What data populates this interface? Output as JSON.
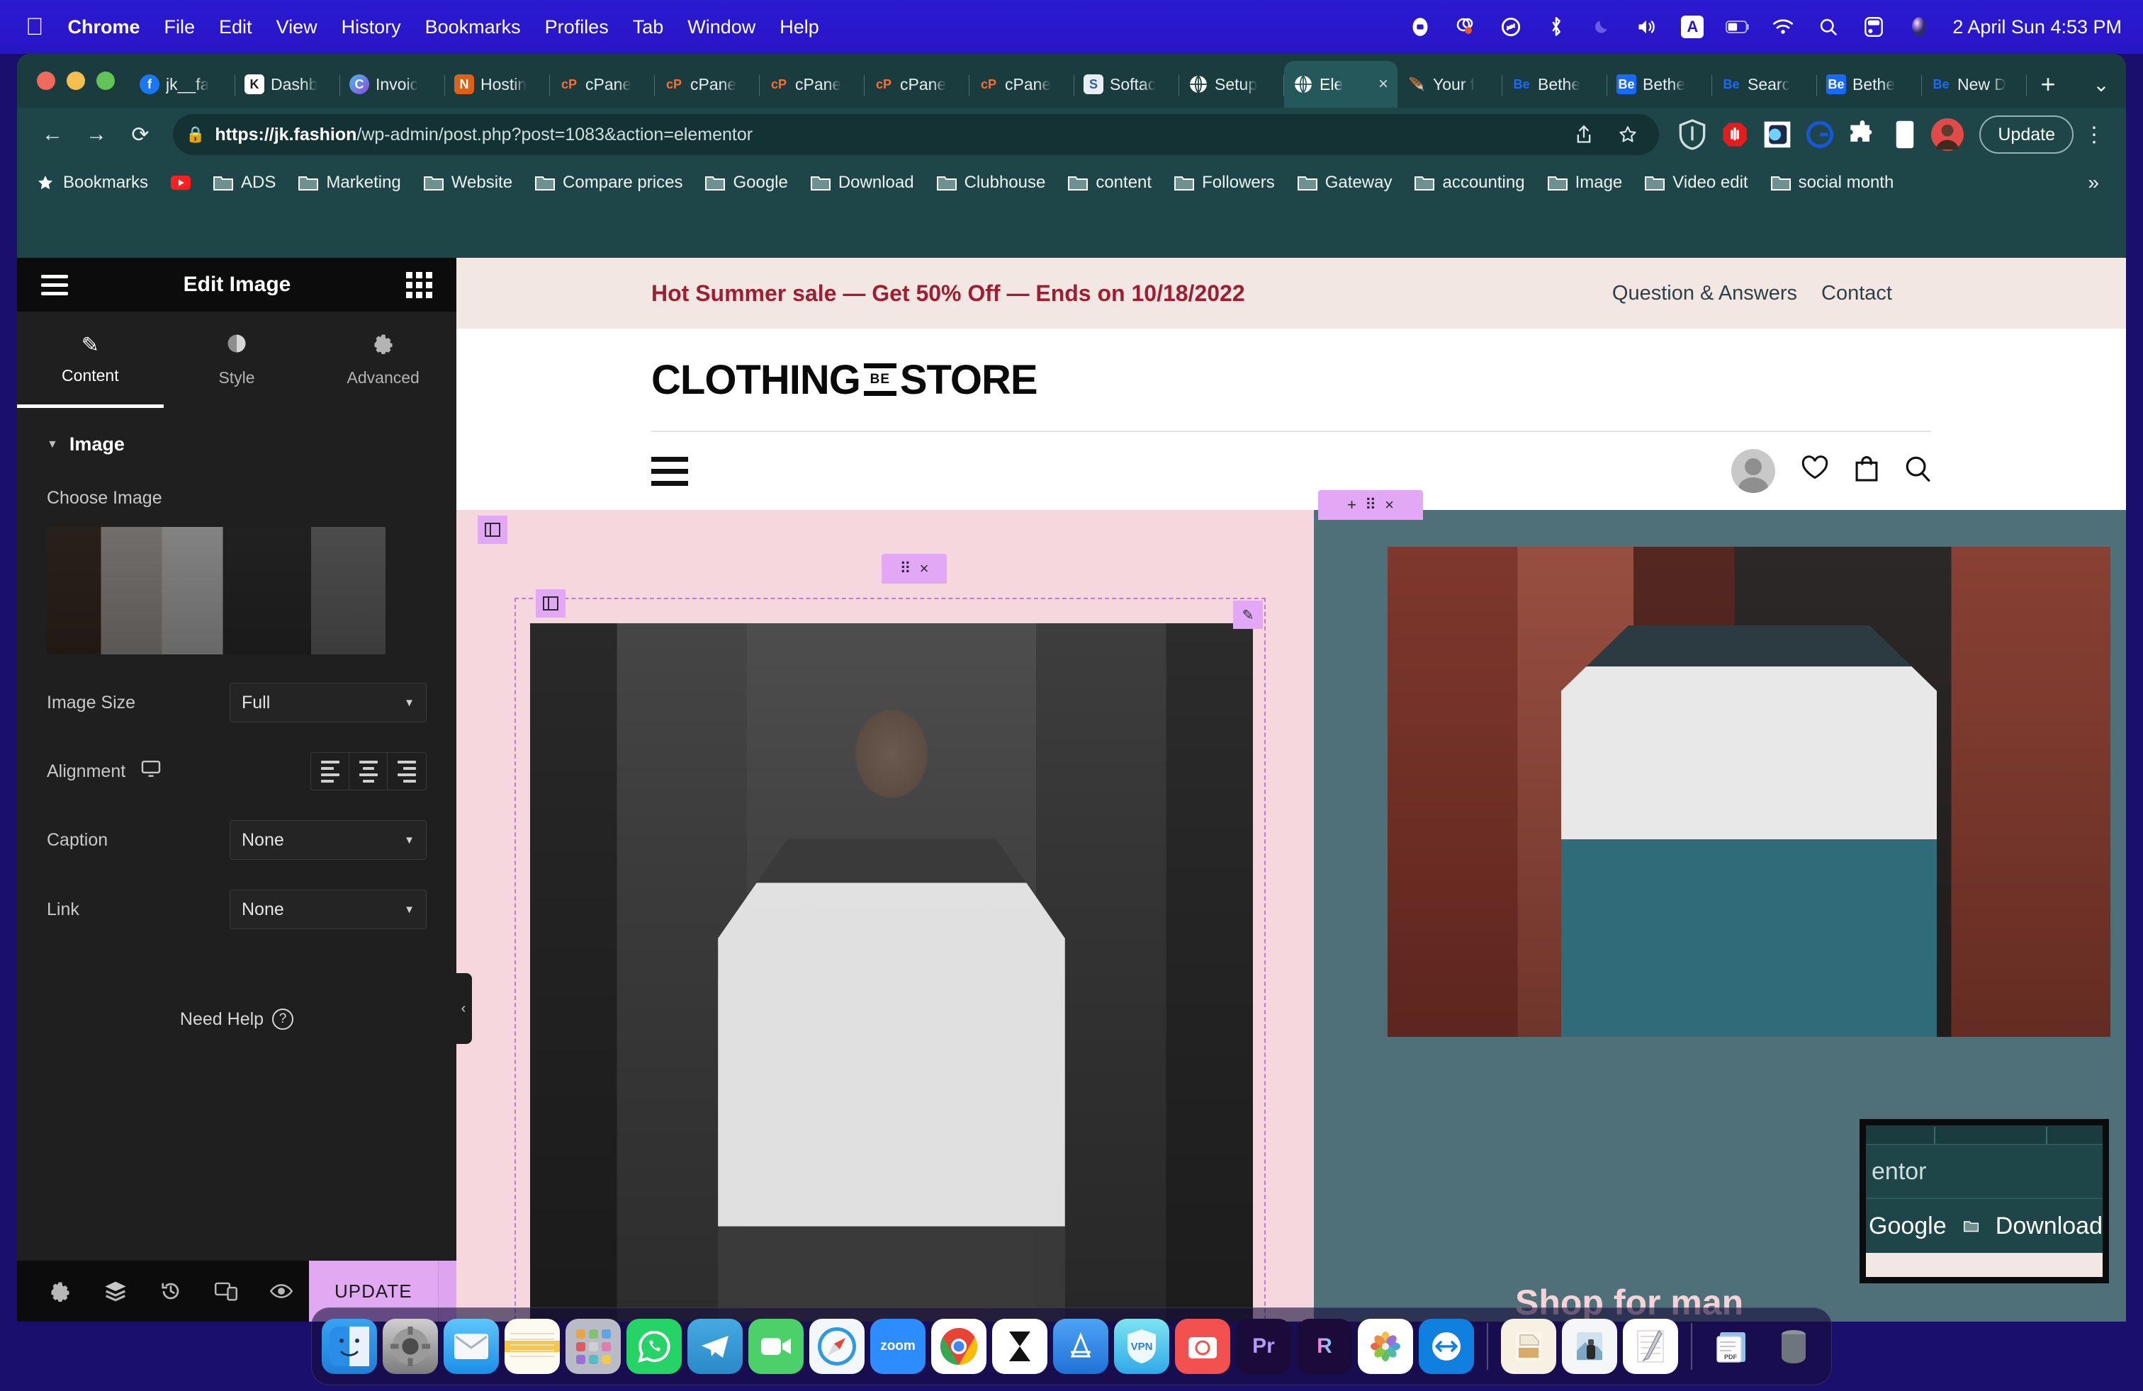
{
  "menubar": {
    "apple_icon": "apple-icon",
    "items": [
      "Chrome",
      "File",
      "Edit",
      "View",
      "History",
      "Bookmarks",
      "Profiles",
      "Tab",
      "Window",
      "Help"
    ],
    "status_icons": [
      "record-icon",
      "loom-icon",
      "shazam-icon",
      "bluetooth-icon",
      "do-not-disturb-moon-icon",
      "volume-icon",
      "input-source-a-icon",
      "battery-icon",
      "wifi-icon",
      "spotlight-search-icon",
      "control-center-icon",
      "siri-icon"
    ],
    "clock": "2 April Sun  4:53 PM"
  },
  "chrome": {
    "tabs": [
      {
        "label": "jk__fa",
        "favicon": "facebook-icon",
        "active": false
      },
      {
        "label": "Dashb",
        "favicon": "wordpress-k-icon",
        "active": false
      },
      {
        "label": "Invoic",
        "favicon": "circle-c-icon",
        "active": false
      },
      {
        "label": "Hostin",
        "favicon": "namecheap-icon",
        "active": false
      },
      {
        "label": "cPane",
        "favicon": "cpanel-icon",
        "active": false
      },
      {
        "label": "cPane",
        "favicon": "cpanel-icon",
        "active": false
      },
      {
        "label": "cPane",
        "favicon": "cpanel-icon",
        "active": false
      },
      {
        "label": "cPane",
        "favicon": "cpanel-icon",
        "active": false
      },
      {
        "label": "cPane",
        "favicon": "cpanel-icon",
        "active": false
      },
      {
        "label": "Softac",
        "favicon": "softaculous-icon",
        "active": false
      },
      {
        "label": "Setup",
        "favicon": "globe-icon",
        "active": false
      },
      {
        "label": "Ele",
        "favicon": "globe-icon",
        "active": true,
        "close": "×"
      },
      {
        "label": "Your f",
        "favicon": "feather-icon",
        "active": false
      },
      {
        "label": "Bethe",
        "favicon": "behance-icon",
        "active": false
      },
      {
        "label": "Bethe",
        "favicon": "behance-icon",
        "active": false
      },
      {
        "label": "Searc",
        "favicon": "behance-icon",
        "active": false
      },
      {
        "label": "Bethe",
        "favicon": "behance-icon",
        "active": false
      },
      {
        "label": "New D",
        "favicon": "behance-icon",
        "active": false
      }
    ],
    "new_tab": "+",
    "tab_list_chevron": "⌄",
    "toolbar": {
      "back": "←",
      "forward": "→",
      "reload": "⟳",
      "lock_icon": "lock-icon",
      "url_domain": "https://jk.fashion",
      "url_path": "/wp-admin/post.php?post=1083&action=elementor",
      "share_icon": "share-icon",
      "bookmark_star_icon": "star-icon",
      "extensions": [
        "shield-icon",
        "adblock-stop-hand-icon",
        "dark-reader-icon",
        "grammarly-c-icon",
        "puzzle-extensions-icon",
        "reading-list-icon",
        "profile-avatar-icon"
      ],
      "update_label": "Update",
      "menu_icon": "kebab-menu-icon"
    },
    "bookmarks_label": "Bookmarks",
    "bookmarks": [
      {
        "label": "",
        "icon": "youtube-icon"
      },
      {
        "label": "ADS",
        "icon": "folder-icon"
      },
      {
        "label": "Marketing",
        "icon": "folder-icon"
      },
      {
        "label": "Website",
        "icon": "folder-icon"
      },
      {
        "label": "Compare prices",
        "icon": "folder-icon"
      },
      {
        "label": "Google",
        "icon": "folder-icon"
      },
      {
        "label": "Download",
        "icon": "folder-icon"
      },
      {
        "label": "Clubhouse",
        "icon": "folder-icon"
      },
      {
        "label": "content",
        "icon": "folder-icon"
      },
      {
        "label": "Followers",
        "icon": "folder-icon"
      },
      {
        "label": "Gateway",
        "icon": "folder-icon"
      },
      {
        "label": "accounting",
        "icon": "folder-icon"
      },
      {
        "label": "Image",
        "icon": "folder-icon"
      },
      {
        "label": "Video edit",
        "icon": "folder-icon"
      },
      {
        "label": "social month",
        "icon": "folder-icon"
      }
    ],
    "bookmarks_overflow": "»"
  },
  "panel": {
    "title": "Edit Image",
    "menu_icon": "hamburger-menu-icon",
    "widgets_icon": "widgets-grid-icon",
    "tabs": [
      {
        "label": "Content",
        "icon": "pencil-icon",
        "active": true
      },
      {
        "label": "Style",
        "icon": "contrast-circle-icon",
        "active": false
      },
      {
        "label": "Advanced",
        "icon": "gear-icon",
        "active": false
      }
    ],
    "section_title": "Image",
    "section_caret": "▼",
    "choose_image_label": "Choose Image",
    "fields": [
      {
        "label": "Image Size",
        "value": "Full",
        "type": "select"
      },
      {
        "label": "Alignment",
        "value": "",
        "type": "align",
        "device_icon": "desktop-icon",
        "options": [
          "align-left",
          "align-center",
          "align-right"
        ]
      },
      {
        "label": "Caption",
        "value": "None",
        "type": "select"
      },
      {
        "label": "Link",
        "value": "None",
        "type": "select"
      }
    ],
    "need_help": "Need Help",
    "need_help_icon": "question-circle-icon",
    "footer_icons": [
      "settings-gear-icon",
      "navigator-layers-icon",
      "history-icon",
      "responsive-mode-icon",
      "preview-eye-icon"
    ],
    "update_label": "UPDATE",
    "update_caret": "⌃",
    "collapse_icon": "‹"
  },
  "preview": {
    "promo_text": "Hot Summer sale — Get 50% Off — Ends on 10/18/2022",
    "promo_color": "#9e1f33",
    "promo_bg": "#f3e7e3",
    "top_links": [
      "Question & Answers",
      "Contact"
    ],
    "logo": {
      "part1": "CLOTHING",
      "badge": "BE",
      "part2": "STORE"
    },
    "nav_menu_icon": "hamburger-menu-icon",
    "nav_icons": [
      "account-avatar-icon",
      "heart-wishlist-icon",
      "shopping-bag-icon",
      "search-icon"
    ],
    "left_section_bg": "#f6d7de",
    "right_section_bg": "#4f7079",
    "shop_link": "Shop for man",
    "shop_link_color": "#f7d3d7",
    "handles": {
      "add_section": "+",
      "drag_dots": "⠿",
      "close": "×",
      "column_icon": "column-handle-icon",
      "edit_pencil": "✎"
    }
  },
  "magnifier": {
    "line1": "entor",
    "line2_a": "Google",
    "line2_b": "Download",
    "folder_icon": "folder-icon"
  },
  "dock": {
    "apps": [
      {
        "name": "finder-icon",
        "running": true
      },
      {
        "name": "system-settings-icon",
        "running": true
      },
      {
        "name": "mail-icon",
        "running": false
      },
      {
        "name": "notes-icon",
        "running": false
      },
      {
        "name": "launchpad-icon",
        "running": false
      },
      {
        "name": "whatsapp-icon",
        "running": true
      },
      {
        "name": "telegram-icon",
        "running": false
      },
      {
        "name": "facetime-icon",
        "running": true
      },
      {
        "name": "safari-icon",
        "running": true
      },
      {
        "name": "zoom-icon",
        "running": true
      },
      {
        "name": "chrome-icon",
        "running": true
      },
      {
        "name": "hourglass-icon",
        "running": false
      },
      {
        "name": "app-store-icon",
        "running": false
      },
      {
        "name": "vpn-icon",
        "running": true
      },
      {
        "name": "cleanshot-icon",
        "running": false
      },
      {
        "name": "premiere-pro-icon",
        "running": false
      },
      {
        "name": "rive-icon",
        "running": false
      },
      {
        "name": "photos-icon",
        "running": false
      },
      {
        "name": "teamviewer-icon",
        "running": false
      },
      {
        "name": "archive-icon",
        "running": false
      },
      {
        "name": "preview-icon",
        "running": false
      },
      {
        "name": "textedit-icon",
        "running": false
      },
      {
        "name": "downloads-stack-icon",
        "running": false
      },
      {
        "name": "trash-icon",
        "running": false
      }
    ],
    "zoom_label": "zoom",
    "premiere_label": "Pr",
    "vpn_label": "VPN"
  }
}
